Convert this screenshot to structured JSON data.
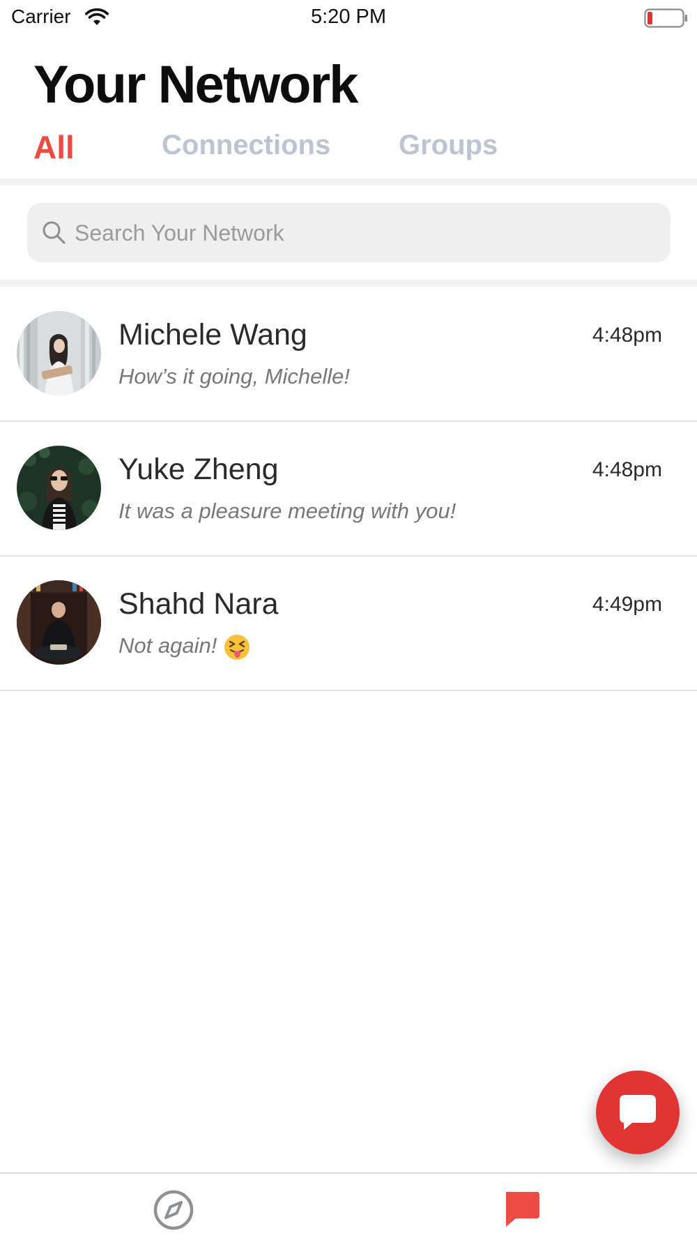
{
  "status_bar": {
    "carrier": "Carrier",
    "time": "5:20 PM",
    "icons": [
      "wifi-icon",
      "battery-icon"
    ]
  },
  "header": {
    "title": "Your Network"
  },
  "tabs": [
    {
      "label": "All",
      "active": true
    },
    {
      "label": "Connections",
      "active": false
    },
    {
      "label": "Groups",
      "active": false
    }
  ],
  "search": {
    "placeholder": "Search Your Network",
    "value": "",
    "icon": "search-icon"
  },
  "conversations": [
    {
      "name": "Michele Wang",
      "time": "4:48pm",
      "preview": "How’s it going, Michelle!"
    },
    {
      "name": "Yuke Zheng",
      "time": "4:48pm",
      "preview": "It was a pleasure meeting with you!"
    },
    {
      "name": "Shahd Nara",
      "time": "4:49pm",
      "preview": "Not again!",
      "emoji": "squinting-face-with-tongue"
    }
  ],
  "fab": {
    "icon": "compose-message-icon"
  },
  "bottom_nav": [
    {
      "icon": "compass-icon",
      "active": false
    },
    {
      "icon": "message-icon",
      "active": true
    }
  ],
  "colors": {
    "accent": "#ee4b45",
    "fab": "#e03532",
    "inactive_tab": "#bcc3d1",
    "inactive_icon": "#8e9194"
  }
}
